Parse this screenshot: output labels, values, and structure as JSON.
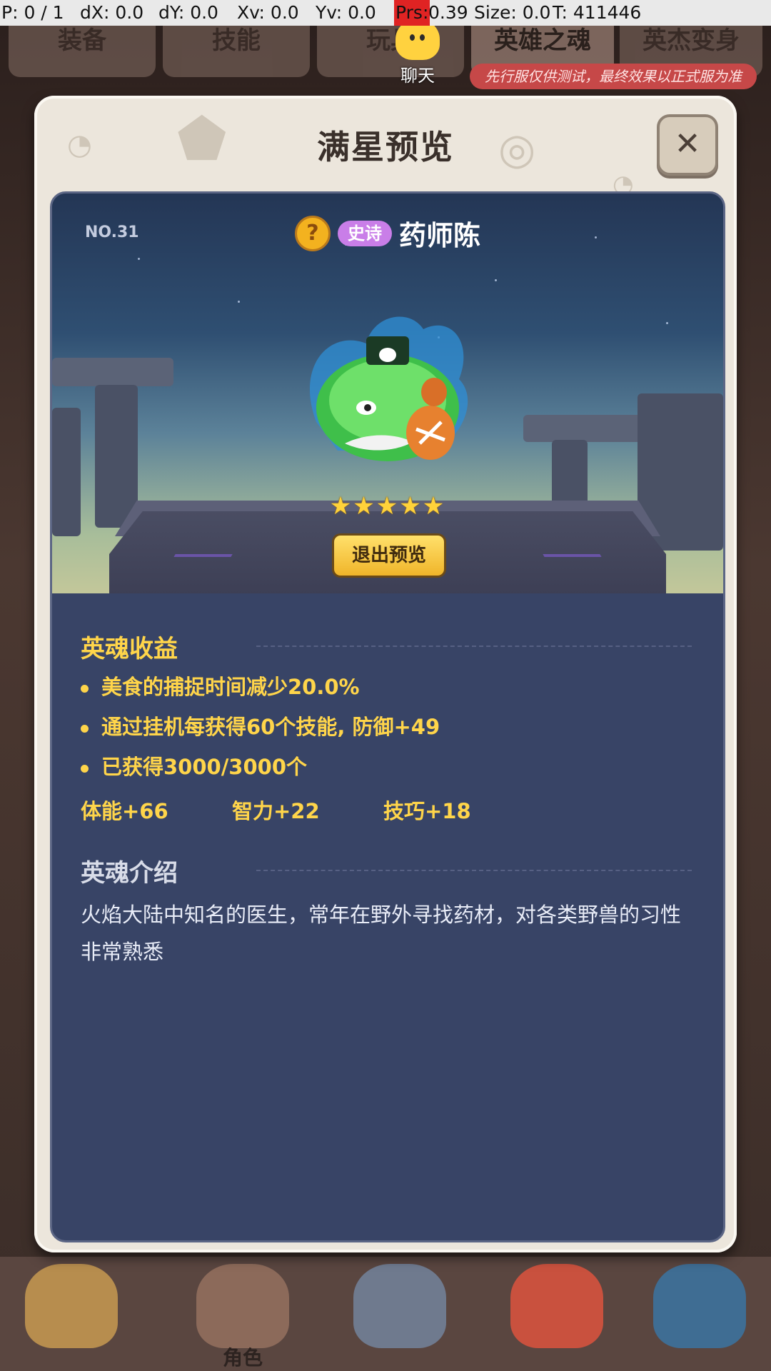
{
  "debug": {
    "p": "P: 0 / 1",
    "dx": "dX: 0.0",
    "dy": "dY: 0.0",
    "xv": "Xv: 0.0",
    "yv": "Yv: 0.0",
    "prs_key": "Prs:",
    "prs_val": "0.39",
    "size": "Size: 0.0",
    "t": "T: 411446"
  },
  "top_tabs": [
    "装备",
    "技能",
    "玩具",
    "英雄之魂",
    "英杰变身"
  ],
  "chat_label": "聊天",
  "notice": "先行服仅供测试，最终效果以正式服为准",
  "modal": {
    "title": "满星预览",
    "close_icon": "close-icon"
  },
  "hero": {
    "number": "NO.31",
    "rarity": "史诗",
    "name": "药师陈",
    "stars": "★★★★★",
    "star_count": 5,
    "exit_label": "退出预览"
  },
  "benefits": {
    "title": "英魂收益",
    "items": [
      "美食的捕捉时间减少20.0%",
      "通过挂机每获得60个技能, 防御+49",
      "已获得3000/3000个"
    ],
    "stats": [
      "体能+66",
      "智力+22",
      "技巧+18"
    ]
  },
  "intro": {
    "title": "英魂介绍",
    "text": "火焰大陆中知名的医生，常年在野外寻找药材，对各类野兽的习性非常熟悉"
  },
  "bottom_nav": {
    "role_label": "角色"
  },
  "colors": {
    "accent_gold": "#ffd54a",
    "rarity_purple": "#c97ee8",
    "panel_navy": "#384466"
  }
}
